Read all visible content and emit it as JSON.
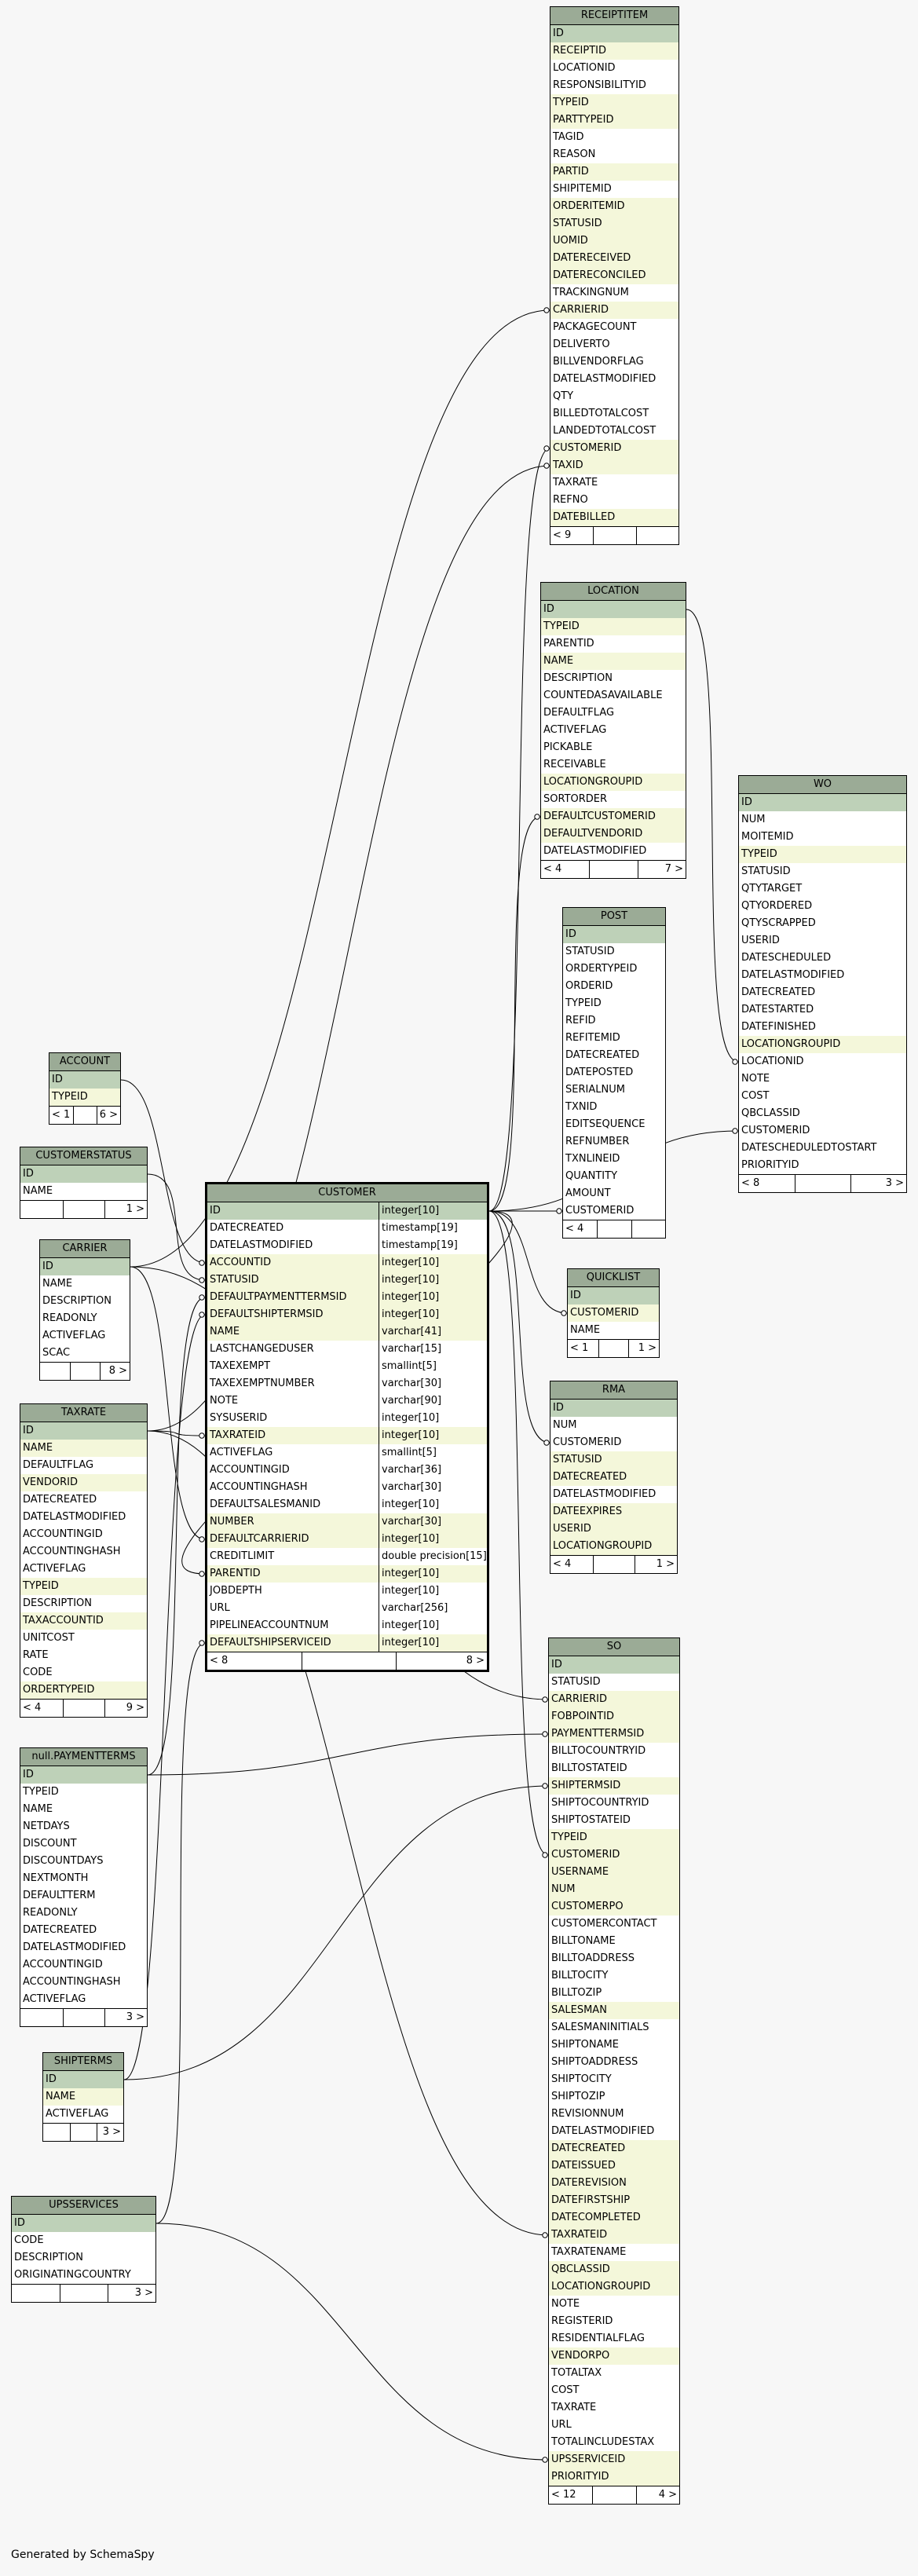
{
  "colors": {
    "title": "#9bab96",
    "primary_key": "#bed1b8",
    "foreign_key": "#f4f7da",
    "column": "#ffffff",
    "line": "#000000"
  },
  "footer": "Generated by SchemaSpy",
  "tables": [
    {
      "name": "RECEIPTITEM",
      "footer": {
        "left": "< 9",
        "right": ""
      },
      "columns": [
        [
          "ID",
          "pk"
        ],
        [
          "RECEIPTID",
          "fk"
        ],
        [
          "LOCATIONID",
          "p"
        ],
        [
          "RESPONSIBILITYID",
          "p"
        ],
        [
          "TYPEID",
          "fk"
        ],
        [
          "PARTTYPEID",
          "fk"
        ],
        [
          "TAGID",
          "p"
        ],
        [
          "REASON",
          "p"
        ],
        [
          "PARTID",
          "fk"
        ],
        [
          "SHIPITEMID",
          "p"
        ],
        [
          "ORDERITEMID",
          "fk"
        ],
        [
          "STATUSID",
          "fk"
        ],
        [
          "UOMID",
          "fk"
        ],
        [
          "DATERECEIVED",
          "fk"
        ],
        [
          "DATERECONCILED",
          "fk"
        ],
        [
          "TRACKINGNUM",
          "p"
        ],
        [
          "CARRIERID",
          "fk"
        ],
        [
          "PACKAGECOUNT",
          "p"
        ],
        [
          "DELIVERTO",
          "p"
        ],
        [
          "BILLVENDORFLAG",
          "p"
        ],
        [
          "DATELASTMODIFIED",
          "p"
        ],
        [
          "QTY",
          "p"
        ],
        [
          "BILLEDTOTALCOST",
          "p"
        ],
        [
          "LANDEDTOTALCOST",
          "p"
        ],
        [
          "CUSTOMERID",
          "fk"
        ],
        [
          "TAXID",
          "fk"
        ],
        [
          "TAXRATE",
          "p"
        ],
        [
          "REFNO",
          "p"
        ],
        [
          "DATEBILLED",
          "fk"
        ]
      ]
    },
    {
      "name": "LOCATION",
      "footer": {
        "left": "< 4",
        "right": "7 >"
      },
      "columns": [
        [
          "ID",
          "pk"
        ],
        [
          "TYPEID",
          "fk"
        ],
        [
          "PARENTID",
          "p"
        ],
        [
          "NAME",
          "fk"
        ],
        [
          "DESCRIPTION",
          "p"
        ],
        [
          "COUNTEDASAVAILABLE",
          "p"
        ],
        [
          "DEFAULTFLAG",
          "p"
        ],
        [
          "ACTIVEFLAG",
          "p"
        ],
        [
          "PICKABLE",
          "p"
        ],
        [
          "RECEIVABLE",
          "p"
        ],
        [
          "LOCATIONGROUPID",
          "fk"
        ],
        [
          "SORTORDER",
          "p"
        ],
        [
          "DEFAULTCUSTOMERID",
          "fk"
        ],
        [
          "DEFAULTVENDORID",
          "fk"
        ],
        [
          "DATELASTMODIFIED",
          "p"
        ]
      ]
    },
    {
      "name": "WO",
      "footer": {
        "left": "< 8",
        "right": "3 >"
      },
      "columns": [
        [
          "ID",
          "pk"
        ],
        [
          "NUM",
          "p"
        ],
        [
          "MOITEMID",
          "p"
        ],
        [
          "TYPEID",
          "fk"
        ],
        [
          "STATUSID",
          "p"
        ],
        [
          "QTYTARGET",
          "p"
        ],
        [
          "QTYORDERED",
          "p"
        ],
        [
          "QTYSCRAPPED",
          "p"
        ],
        [
          "USERID",
          "p"
        ],
        [
          "DATESCHEDULED",
          "p"
        ],
        [
          "DATELASTMODIFIED",
          "p"
        ],
        [
          "DATECREATED",
          "p"
        ],
        [
          "DATESTARTED",
          "p"
        ],
        [
          "DATEFINISHED",
          "p"
        ],
        [
          "LOCATIONGROUPID",
          "fk"
        ],
        [
          "LOCATIONID",
          "p"
        ],
        [
          "NOTE",
          "p"
        ],
        [
          "COST",
          "p"
        ],
        [
          "QBCLASSID",
          "p"
        ],
        [
          "CUSTOMERID",
          "p"
        ],
        [
          "DATESCHEDULEDTOSTART",
          "p"
        ],
        [
          "PRIORITYID",
          "p"
        ]
      ]
    },
    {
      "name": "POST",
      "footer": {
        "left": "< 4",
        "right": ""
      },
      "columns": [
        [
          "ID",
          "pk"
        ],
        [
          "STATUSID",
          "p"
        ],
        [
          "ORDERTYPEID",
          "p"
        ],
        [
          "ORDERID",
          "p"
        ],
        [
          "TYPEID",
          "p"
        ],
        [
          "REFID",
          "p"
        ],
        [
          "REFITEMID",
          "p"
        ],
        [
          "DATECREATED",
          "p"
        ],
        [
          "DATEPOSTED",
          "p"
        ],
        [
          "SERIALNUM",
          "p"
        ],
        [
          "TXNID",
          "p"
        ],
        [
          "EDITSEQUENCE",
          "p"
        ],
        [
          "REFNUMBER",
          "p"
        ],
        [
          "TXNLINEID",
          "p"
        ],
        [
          "QUANTITY",
          "p"
        ],
        [
          "AMOUNT",
          "p"
        ],
        [
          "CUSTOMERID",
          "p"
        ]
      ]
    },
    {
      "name": "QUICKLIST",
      "footer": {
        "left": "< 1",
        "right": "1 >"
      },
      "columns": [
        [
          "ID",
          "pk"
        ],
        [
          "CUSTOMERID",
          "fk"
        ],
        [
          "NAME",
          "p"
        ]
      ]
    },
    {
      "name": "RMA",
      "footer": {
        "left": "< 4",
        "right": "1 >"
      },
      "columns": [
        [
          "ID",
          "pk"
        ],
        [
          "NUM",
          "p"
        ],
        [
          "CUSTOMERID",
          "p"
        ],
        [
          "STATUSID",
          "fk"
        ],
        [
          "DATECREATED",
          "fk"
        ],
        [
          "DATELASTMODIFIED",
          "p"
        ],
        [
          "DATEEXPIRES",
          "fk"
        ],
        [
          "USERID",
          "fk"
        ],
        [
          "LOCATIONGROUPID",
          "fk"
        ]
      ]
    },
    {
      "name": "SO",
      "footer": {
        "left": "< 12",
        "right": "4 >"
      },
      "columns": [
        [
          "ID",
          "pk"
        ],
        [
          "STATUSID",
          "p"
        ],
        [
          "CARRIERID",
          "fk"
        ],
        [
          "FOBPOINTID",
          "fk"
        ],
        [
          "PAYMENTTERMSID",
          "fk"
        ],
        [
          "BILLTOCOUNTRYID",
          "p"
        ],
        [
          "BILLTOSTATEID",
          "p"
        ],
        [
          "SHIPTERMSID",
          "fk"
        ],
        [
          "SHIPTOCOUNTRYID",
          "p"
        ],
        [
          "SHIPTOSTATEID",
          "p"
        ],
        [
          "TYPEID",
          "fk"
        ],
        [
          "CUSTOMERID",
          "fk"
        ],
        [
          "USERNAME",
          "fk"
        ],
        [
          "NUM",
          "fk"
        ],
        [
          "CUSTOMERPO",
          "fk"
        ],
        [
          "CUSTOMERCONTACT",
          "p"
        ],
        [
          "BILLTONAME",
          "p"
        ],
        [
          "BILLTOADDRESS",
          "p"
        ],
        [
          "BILLTOCITY",
          "p"
        ],
        [
          "BILLTOZIP",
          "p"
        ],
        [
          "SALESMAN",
          "fk"
        ],
        [
          "SALESMANINITIALS",
          "p"
        ],
        [
          "SHIPTONAME",
          "p"
        ],
        [
          "SHIPTOADDRESS",
          "p"
        ],
        [
          "SHIPTOCITY",
          "p"
        ],
        [
          "SHIPTOZIP",
          "p"
        ],
        [
          "REVISIONNUM",
          "p"
        ],
        [
          "DATELASTMODIFIED",
          "p"
        ],
        [
          "DATECREATED",
          "fk"
        ],
        [
          "DATEISSUED",
          "fk"
        ],
        [
          "DATEREVISION",
          "fk"
        ],
        [
          "DATEFIRSTSHIP",
          "fk"
        ],
        [
          "DATECOMPLETED",
          "fk"
        ],
        [
          "TAXRATEID",
          "fk"
        ],
        [
          "TAXRATENAME",
          "p"
        ],
        [
          "QBCLASSID",
          "fk"
        ],
        [
          "LOCATIONGROUPID",
          "fk"
        ],
        [
          "NOTE",
          "p"
        ],
        [
          "REGISTERID",
          "p"
        ],
        [
          "RESIDENTIALFLAG",
          "p"
        ],
        [
          "VENDORPO",
          "fk"
        ],
        [
          "TOTALTAX",
          "p"
        ],
        [
          "COST",
          "p"
        ],
        [
          "TAXRATE",
          "p"
        ],
        [
          "URL",
          "p"
        ],
        [
          "TOTALINCLUDESTAX",
          "p"
        ],
        [
          "UPSSERVICEID",
          "fk"
        ],
        [
          "PRIORITYID",
          "fk"
        ]
      ]
    },
    {
      "name": "CUSTOMER",
      "footer": {
        "left": "< 8",
        "right": "8 >"
      },
      "columns": [
        [
          "ID",
          "pk",
          "integer[10]"
        ],
        [
          "DATECREATED",
          "p",
          "timestamp[19]"
        ],
        [
          "DATELASTMODIFIED",
          "p",
          "timestamp[19]"
        ],
        [
          "ACCOUNTID",
          "fk",
          "integer[10]"
        ],
        [
          "STATUSID",
          "fk",
          "integer[10]"
        ],
        [
          "DEFAULTPAYMENTTERMSID",
          "fk",
          "integer[10]"
        ],
        [
          "DEFAULTSHIPTERMSID",
          "fk",
          "integer[10]"
        ],
        [
          "NAME",
          "fk",
          "varchar[41]"
        ],
        [
          "LASTCHANGEDUSER",
          "p",
          "varchar[15]"
        ],
        [
          "TAXEXEMPT",
          "p",
          "smallint[5]"
        ],
        [
          "TAXEXEMPTNUMBER",
          "p",
          "varchar[30]"
        ],
        [
          "NOTE",
          "p",
          "varchar[90]"
        ],
        [
          "SYSUSERID",
          "p",
          "integer[10]"
        ],
        [
          "TAXRATEID",
          "fk",
          "integer[10]"
        ],
        [
          "ACTIVEFLAG",
          "p",
          "smallint[5]"
        ],
        [
          "ACCOUNTINGID",
          "p",
          "varchar[36]"
        ],
        [
          "ACCOUNTINGHASH",
          "p",
          "varchar[30]"
        ],
        [
          "DEFAULTSALESMANID",
          "p",
          "integer[10]"
        ],
        [
          "NUMBER",
          "fk",
          "varchar[30]"
        ],
        [
          "DEFAULTCARRIERID",
          "fk",
          "integer[10]"
        ],
        [
          "CREDITLIMIT",
          "p",
          "double precision[15]"
        ],
        [
          "PARENTID",
          "fk",
          "integer[10]"
        ],
        [
          "JOBDEPTH",
          "p",
          "integer[10]"
        ],
        [
          "URL",
          "p",
          "varchar[256]"
        ],
        [
          "PIPELINEACCOUNTNUM",
          "p",
          "integer[10]"
        ],
        [
          "DEFAULTSHIPSERVICEID",
          "fk",
          "integer[10]"
        ]
      ]
    },
    {
      "name": "ACCOUNT",
      "footer": {
        "left": "< 1",
        "right": "6 >"
      },
      "columns": [
        [
          "ID",
          "pk"
        ],
        [
          "TYPEID",
          "fk"
        ]
      ]
    },
    {
      "name": "CUSTOMERSTATUS",
      "footer": {
        "left": "",
        "right": "1 >"
      },
      "columns": [
        [
          "ID",
          "pk"
        ],
        [
          "NAME",
          "p"
        ]
      ]
    },
    {
      "name": "CARRIER",
      "footer": {
        "left": "",
        "right": "8 >"
      },
      "columns": [
        [
          "ID",
          "pk"
        ],
        [
          "NAME",
          "p"
        ],
        [
          "DESCRIPTION",
          "p"
        ],
        [
          "READONLY",
          "p"
        ],
        [
          "ACTIVEFLAG",
          "p"
        ],
        [
          "SCAC",
          "p"
        ]
      ]
    },
    {
      "name": "TAXRATE",
      "footer": {
        "left": "< 4",
        "right": "9 >"
      },
      "columns": [
        [
          "ID",
          "pk"
        ],
        [
          "NAME",
          "fk"
        ],
        [
          "DEFAULTFLAG",
          "p"
        ],
        [
          "VENDORID",
          "fk"
        ],
        [
          "DATECREATED",
          "p"
        ],
        [
          "DATELASTMODIFIED",
          "p"
        ],
        [
          "ACCOUNTINGID",
          "p"
        ],
        [
          "ACCOUNTINGHASH",
          "p"
        ],
        [
          "ACTIVEFLAG",
          "p"
        ],
        [
          "TYPEID",
          "fk"
        ],
        [
          "DESCRIPTION",
          "p"
        ],
        [
          "TAXACCOUNTID",
          "fk"
        ],
        [
          "UNITCOST",
          "p"
        ],
        [
          "RATE",
          "p"
        ],
        [
          "CODE",
          "p"
        ],
        [
          "ORDERTYPEID",
          "fk"
        ]
      ]
    },
    {
      "name": "null.PAYMENTTERMS",
      "footer": {
        "left": "",
        "right": "3 >"
      },
      "columns": [
        [
          "ID",
          "pk"
        ],
        [
          "TYPEID",
          "p"
        ],
        [
          "NAME",
          "p"
        ],
        [
          "NETDAYS",
          "p"
        ],
        [
          "DISCOUNT",
          "p"
        ],
        [
          "DISCOUNTDAYS",
          "p"
        ],
        [
          "NEXTMONTH",
          "p"
        ],
        [
          "DEFAULTTERM",
          "p"
        ],
        [
          "READONLY",
          "p"
        ],
        [
          "DATECREATED",
          "p"
        ],
        [
          "DATELASTMODIFIED",
          "p"
        ],
        [
          "ACCOUNTINGID",
          "p"
        ],
        [
          "ACCOUNTINGHASH",
          "p"
        ],
        [
          "ACTIVEFLAG",
          "p"
        ]
      ]
    },
    {
      "name": "SHIPTERMS",
      "footer": {
        "left": "",
        "right": "3 >"
      },
      "columns": [
        [
          "ID",
          "pk"
        ],
        [
          "NAME",
          "fk"
        ],
        [
          "ACTIVEFLAG",
          "p"
        ]
      ]
    },
    {
      "name": "UPSSERVICES",
      "footer": {
        "left": "",
        "right": "3 >"
      },
      "columns": [
        [
          "ID",
          "pk"
        ],
        [
          "CODE",
          "p"
        ],
        [
          "DESCRIPTION",
          "p"
        ],
        [
          "ORIGINATINGCOUNTRY",
          "p"
        ]
      ]
    }
  ]
}
